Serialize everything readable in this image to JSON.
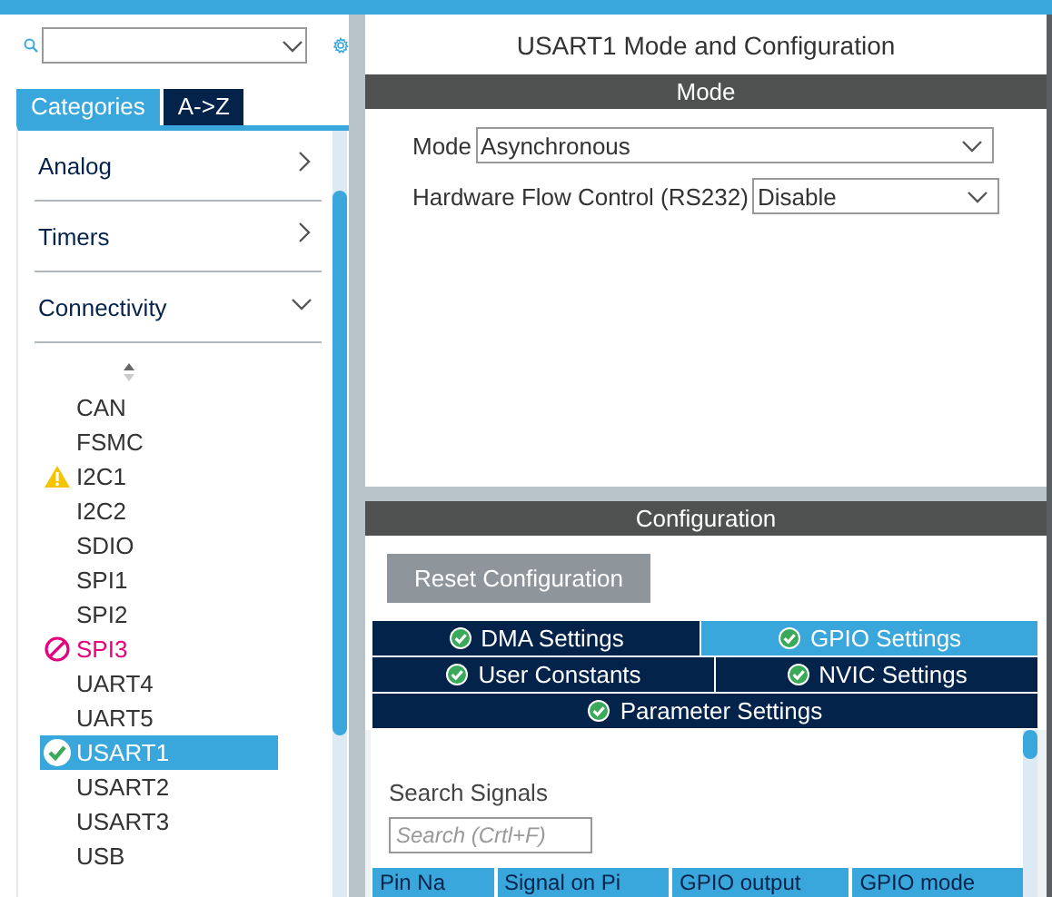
{
  "sidebar": {
    "tabs": [
      {
        "label": "Categories",
        "selected": true
      },
      {
        "label": "A->Z",
        "selected": false
      }
    ],
    "categories": [
      {
        "label": "Analog",
        "expanded": false
      },
      {
        "label": "Timers",
        "expanded": false
      },
      {
        "label": "Connectivity",
        "expanded": true,
        "children": [
          {
            "label": "CAN",
            "kind": "plain",
            "selected": false
          },
          {
            "label": "FSMC",
            "kind": "plain",
            "selected": false
          },
          {
            "label": "I2C1",
            "kind": "warning",
            "selected": false
          },
          {
            "label": "I2C2",
            "kind": "plain",
            "selected": false
          },
          {
            "label": "SDIO",
            "kind": "plain",
            "selected": false
          },
          {
            "label": "SPI1",
            "kind": "plain",
            "selected": false
          },
          {
            "label": "SPI2",
            "kind": "plain",
            "selected": false
          },
          {
            "label": "SPI3",
            "kind": "blocked",
            "selected": false
          },
          {
            "label": "UART4",
            "kind": "plain",
            "selected": false
          },
          {
            "label": "UART5",
            "kind": "plain",
            "selected": false
          },
          {
            "label": "USART1",
            "kind": "configured",
            "selected": true
          },
          {
            "label": "USART2",
            "kind": "plain",
            "selected": false
          },
          {
            "label": "USART3",
            "kind": "plain",
            "selected": false
          },
          {
            "label": "USB",
            "kind": "plain",
            "selected": false
          }
        ]
      }
    ]
  },
  "main": {
    "title": "USART1 Mode and Configuration",
    "mode": {
      "header": "Mode",
      "fields": [
        {
          "label": "Mode",
          "value": "Asynchronous"
        },
        {
          "label": "Hardware Flow Control (RS232)",
          "value": "Disable"
        }
      ]
    },
    "configuration": {
      "header": "Configuration",
      "reset_button": "Reset Configuration",
      "tab_rows": [
        [
          {
            "label": "DMA Settings",
            "selected": false
          },
          {
            "label": "GPIO Settings",
            "selected": true
          }
        ],
        [
          {
            "label": "User Constants",
            "selected": false
          },
          {
            "label": "NVIC Settings",
            "selected": false
          }
        ],
        [
          {
            "label": "Parameter Settings",
            "selected": false
          }
        ]
      ],
      "search_label": "Search Signals",
      "search_placeholder": "Search (Crtl+F)",
      "table": {
        "columns": [
          "Pin Na",
          "Signal on Pi",
          "GPIO output",
          "GPIO mode"
        ]
      }
    }
  }
}
